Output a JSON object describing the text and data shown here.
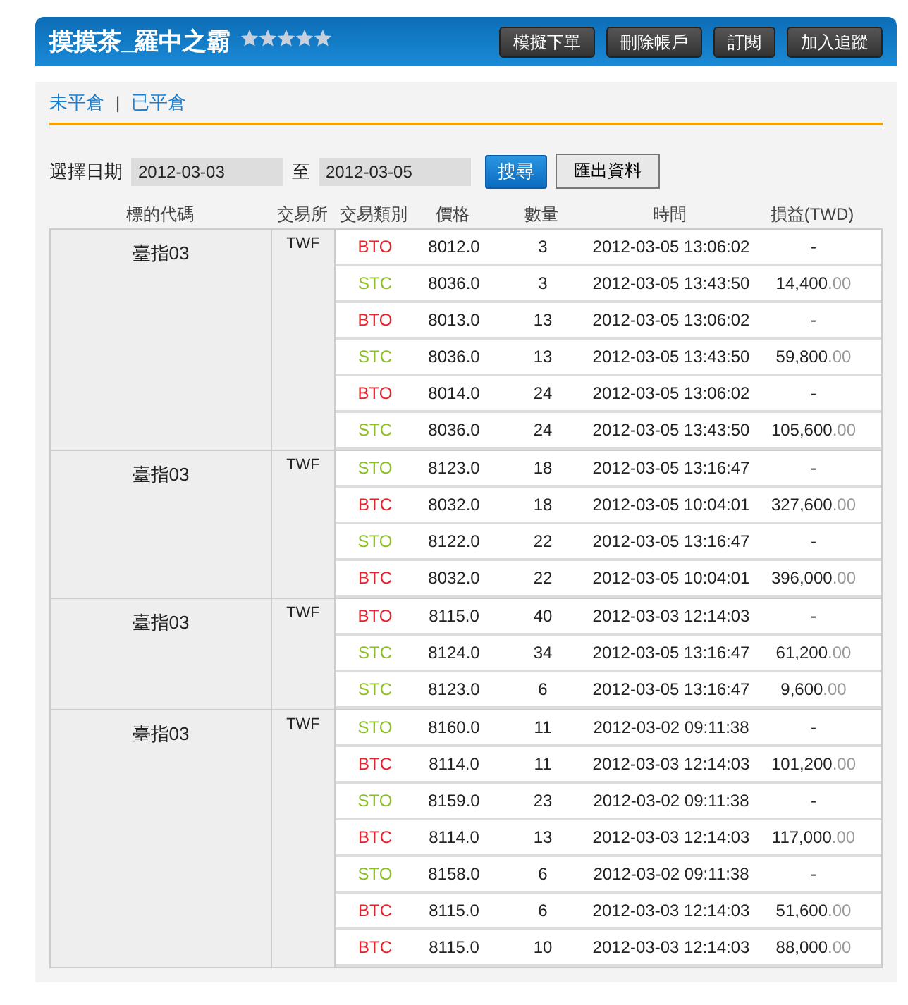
{
  "header": {
    "title": "摸摸茶_羅中之霸",
    "stars": 5,
    "buttons": [
      "模擬下單",
      "刪除帳戶",
      "訂閱",
      "加入追蹤"
    ]
  },
  "tabs": [
    {
      "label": "未平倉",
      "selected": false
    },
    {
      "label": "已平倉",
      "selected": false
    }
  ],
  "tab_separator": "|",
  "filter": {
    "label": "選擇日期",
    "from": "2012-03-03",
    "separator": "至",
    "to": "2012-03-05",
    "search_button": "搜尋",
    "export_button": "匯出資料"
  },
  "table": {
    "columns": [
      "標的代碼",
      "交易所",
      "交易類別",
      "價格",
      "數量",
      "時間",
      "損益(TWD)"
    ],
    "groups": [
      {
        "symbol": "臺指03",
        "exchange": "TWF",
        "trades": [
          {
            "type": "BTO",
            "color": "#e8202a",
            "price": "8012.0",
            "qty": "3",
            "time": "2012-03-05 13:06:02",
            "pnl": "-"
          },
          {
            "type": "STC",
            "color": "#8cbf26",
            "price": "8036.0",
            "qty": "3",
            "time": "2012-03-05 13:43:50",
            "pnl": "14,400",
            "pnl_decimals": ".00"
          },
          {
            "type": "BTO",
            "color": "#e8202a",
            "price": "8013.0",
            "qty": "13",
            "time": "2012-03-05 13:06:02",
            "pnl": "-"
          },
          {
            "type": "STC",
            "color": "#8cbf26",
            "price": "8036.0",
            "qty": "13",
            "time": "2012-03-05 13:43:50",
            "pnl": "59,800",
            "pnl_decimals": ".00"
          },
          {
            "type": "BTO",
            "color": "#e8202a",
            "price": "8014.0",
            "qty": "24",
            "time": "2012-03-05 13:06:02",
            "pnl": "-"
          },
          {
            "type": "STC",
            "color": "#8cbf26",
            "price": "8036.0",
            "qty": "24",
            "time": "2012-03-05 13:43:50",
            "pnl": "105,600",
            "pnl_decimals": ".00"
          }
        ]
      },
      {
        "symbol": "臺指03",
        "exchange": "TWF",
        "trades": [
          {
            "type": "STO",
            "color": "#8cbf26",
            "price": "8123.0",
            "qty": "18",
            "time": "2012-03-05 13:16:47",
            "pnl": "-"
          },
          {
            "type": "BTC",
            "color": "#e8202a",
            "price": "8032.0",
            "qty": "18",
            "time": "2012-03-05 10:04:01",
            "pnl": "327,600",
            "pnl_decimals": ".00"
          },
          {
            "type": "STO",
            "color": "#8cbf26",
            "price": "8122.0",
            "qty": "22",
            "time": "2012-03-05 13:16:47",
            "pnl": "-"
          },
          {
            "type": "BTC",
            "color": "#e8202a",
            "price": "8032.0",
            "qty": "22",
            "time": "2012-03-05 10:04:01",
            "pnl": "396,000",
            "pnl_decimals": ".00"
          }
        ]
      },
      {
        "symbol": "臺指03",
        "exchange": "TWF",
        "trades": [
          {
            "type": "BTO",
            "color": "#e8202a",
            "price": "8115.0",
            "qty": "40",
            "time": "2012-03-03 12:14:03",
            "pnl": "-"
          },
          {
            "type": "STC",
            "color": "#8cbf26",
            "price": "8124.0",
            "qty": "34",
            "time": "2012-03-05 13:16:47",
            "pnl": "61,200",
            "pnl_decimals": ".00"
          },
          {
            "type": "STC",
            "color": "#8cbf26",
            "price": "8123.0",
            "qty": "6",
            "time": "2012-03-05 13:16:47",
            "pnl": "9,600",
            "pnl_decimals": ".00"
          }
        ]
      },
      {
        "symbol": "臺指03",
        "exchange": "TWF",
        "trades": [
          {
            "type": "STO",
            "color": "#8cbf26",
            "price": "8160.0",
            "qty": "11",
            "time": "2012-03-02 09:11:38",
            "pnl": "-"
          },
          {
            "type": "BTC",
            "color": "#e8202a",
            "price": "8114.0",
            "qty": "11",
            "time": "2012-03-03 12:14:03",
            "pnl": "101,200",
            "pnl_decimals": ".00"
          },
          {
            "type": "STO",
            "color": "#8cbf26",
            "price": "8159.0",
            "qty": "23",
            "time": "2012-03-02 09:11:38",
            "pnl": "-"
          },
          {
            "type": "BTC",
            "color": "#e8202a",
            "price": "8114.0",
            "qty": "13",
            "time": "2012-03-03 12:14:03",
            "pnl": "117,000",
            "pnl_decimals": ".00"
          },
          {
            "type": "STO",
            "color": "#8cbf26",
            "price": "8158.0",
            "qty": "6",
            "time": "2012-03-02 09:11:38",
            "pnl": "-"
          },
          {
            "type": "BTC",
            "color": "#e8202a",
            "price": "8115.0",
            "qty": "6",
            "time": "2012-03-03 12:14:03",
            "pnl": "51,600",
            "pnl_decimals": ".00"
          },
          {
            "type": "BTC",
            "color": "#e8202a",
            "price": "8115.0",
            "qty": "10",
            "time": "2012-03-03 12:14:03",
            "pnl": "88,000",
            "pnl_decimals": ".00"
          }
        ]
      }
    ]
  }
}
